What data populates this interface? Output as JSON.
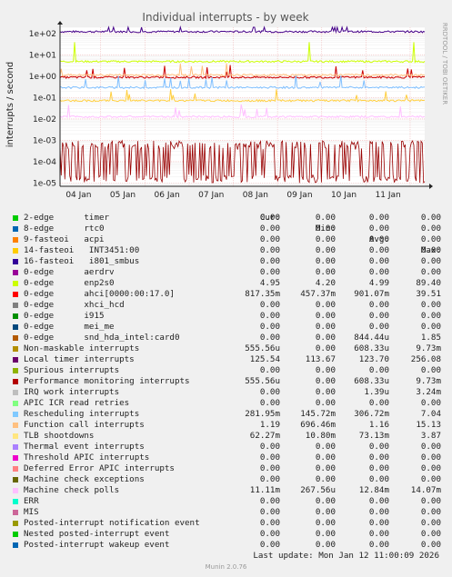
{
  "chart_data": {
    "type": "line",
    "title": "Individual interrupts - by week",
    "ylabel": "interrupts / second",
    "yscale": "log",
    "ylim": [
      7e-06,
      200
    ],
    "yticks": [
      "1e+02",
      "1e+01",
      "1e+00",
      "1e-01",
      "1e-02",
      "1e-03",
      "1e-04",
      "1e-05"
    ],
    "xticks": [
      "04 Jan",
      "05 Jan",
      "06 Jan",
      "07 Jan",
      "08 Jan",
      "09 Jan",
      "10 Jan",
      "11 Jan"
    ],
    "side_text": "RRDTOOL / TOBI OETIKER",
    "grid": true,
    "series": [
      {
        "name": "Local timer interrupts",
        "color": "#440088",
        "level": 125
      },
      {
        "name": "enp2s0",
        "color": "#ccff00",
        "level": 4.99,
        "spikes": true
      },
      {
        "name": "ahci[0000:00:17.0]",
        "color": "#cc0000",
        "level": 0.9
      },
      {
        "name": "Rescheduling interrupts",
        "color": "#7fbfff",
        "level": 0.3
      },
      {
        "name": "Function call interrupts",
        "color": "#ffbf7f",
        "level": 1.16
      },
      {
        "name": "TLB shootdowns",
        "color": "#ffcf40",
        "level": 0.073
      },
      {
        "name": "Machine check polls",
        "color": "#ffbfff",
        "level": 0.0128
      },
      {
        "name": "Performance monitoring interrupts",
        "color": "#990000",
        "level": 0.0006,
        "noisy": true
      }
    ]
  },
  "legend": {
    "headers": {
      "cur": "Cur:",
      "min": "Min:",
      "avg": "Avg:",
      "max": "Max:"
    },
    "rows": [
      {
        "label": "2-edge      timer",
        "color": "#00cc00",
        "cur": "0.00",
        "min": "0.00",
        "avg": "0.00",
        "max": "0.00"
      },
      {
        "label": "8-edge      rtc0",
        "color": "#0066b3",
        "cur": "0.00",
        "min": "0.00",
        "avg": "0.00",
        "max": "0.00"
      },
      {
        "label": "9-fasteoi   acpi",
        "color": "#ff8000",
        "cur": "0.00",
        "min": "0.00",
        "avg": "0.00",
        "max": "0.00"
      },
      {
        "label": "14-fasteoi   INT3451:00",
        "color": "#ffcc00",
        "cur": "0.00",
        "min": "0.00",
        "avg": "0.00",
        "max": "0.00"
      },
      {
        "label": "16-fasteoi   i801_smbus",
        "color": "#330099",
        "cur": "0.00",
        "min": "0.00",
        "avg": "0.00",
        "max": "0.00"
      },
      {
        "label": "0-edge      aerdrv",
        "color": "#990099",
        "cur": "0.00",
        "min": "0.00",
        "avg": "0.00",
        "max": "0.00"
      },
      {
        "label": "0-edge      enp2s0",
        "color": "#ccff00",
        "cur": "4.95",
        "min": "4.20",
        "avg": "4.99",
        "max": "89.40"
      },
      {
        "label": "0-edge      ahci[0000:00:17.0]",
        "color": "#ff0000",
        "cur": "817.35m",
        "min": "457.37m",
        "avg": "901.07m",
        "max": "39.51"
      },
      {
        "label": "0-edge      xhci_hcd",
        "color": "#808080",
        "cur": "0.00",
        "min": "0.00",
        "avg": "0.00",
        "max": "0.00"
      },
      {
        "label": "0-edge      i915",
        "color": "#008f00",
        "cur": "0.00",
        "min": "0.00",
        "avg": "0.00",
        "max": "0.00"
      },
      {
        "label": "0-edge      mei_me",
        "color": "#00487d",
        "cur": "0.00",
        "min": "0.00",
        "avg": "0.00",
        "max": "0.00"
      },
      {
        "label": "0-edge      snd_hda_intel:card0",
        "color": "#b35a00",
        "cur": "0.00",
        "min": "0.00",
        "avg": "844.44u",
        "max": "1.85"
      },
      {
        "label": "Non-maskable interrupts",
        "color": "#b38f00",
        "cur": "555.56u",
        "min": "0.00",
        "avg": "608.33u",
        "max": "9.73m"
      },
      {
        "label": "Local timer interrupts",
        "color": "#6b006b",
        "cur": "125.54",
        "min": "113.67",
        "avg": "123.70",
        "max": "256.08"
      },
      {
        "label": "Spurious interrupts",
        "color": "#8fb300",
        "cur": "0.00",
        "min": "0.00",
        "avg": "0.00",
        "max": "0.00"
      },
      {
        "label": "Performance monitoring interrupts",
        "color": "#b30000",
        "cur": "555.56u",
        "min": "0.00",
        "avg": "608.33u",
        "max": "9.73m"
      },
      {
        "label": "IRQ work interrupts",
        "color": "#bebebe",
        "cur": "0.00",
        "min": "0.00",
        "avg": "1.39u",
        "max": "3.24m"
      },
      {
        "label": "APIC ICR read retries",
        "color": "#80ff80",
        "cur": "0.00",
        "min": "0.00",
        "avg": "0.00",
        "max": "0.00"
      },
      {
        "label": "Rescheduling interrupts",
        "color": "#80c9ff",
        "cur": "281.95m",
        "min": "145.72m",
        "avg": "306.72m",
        "max": "7.04"
      },
      {
        "label": "Function call interrupts",
        "color": "#ffc080",
        "cur": "1.19",
        "min": "696.46m",
        "avg": "1.16",
        "max": "15.13"
      },
      {
        "label": "TLB shootdowns",
        "color": "#ffe680",
        "cur": "62.27m",
        "min": "10.80m",
        "avg": "73.13m",
        "max": "3.87"
      },
      {
        "label": "Thermal event interrupts",
        "color": "#aa80ff",
        "cur": "0.00",
        "min": "0.00",
        "avg": "0.00",
        "max": "0.00"
      },
      {
        "label": "Threshold APIC interrupts",
        "color": "#ee00cc",
        "cur": "0.00",
        "min": "0.00",
        "avg": "0.00",
        "max": "0.00"
      },
      {
        "label": "Deferred Error APIC interrupts",
        "color": "#ff8080",
        "cur": "0.00",
        "min": "0.00",
        "avg": "0.00",
        "max": "0.00"
      },
      {
        "label": "Machine check exceptions",
        "color": "#666600",
        "cur": "0.00",
        "min": "0.00",
        "avg": "0.00",
        "max": "0.00"
      },
      {
        "label": "Machine check polls",
        "color": "#ffbfff",
        "cur": "11.11m",
        "min": "267.56u",
        "avg": "12.84m",
        "max": "14.07m"
      },
      {
        "label": "ERR",
        "color": "#00ffcc",
        "cur": "0.00",
        "min": "0.00",
        "avg": "0.00",
        "max": "0.00"
      },
      {
        "label": "MIS",
        "color": "#cc6699",
        "cur": "0.00",
        "min": "0.00",
        "avg": "0.00",
        "max": "0.00"
      },
      {
        "label": "Posted-interrupt notification event",
        "color": "#999900",
        "cur": "0.00",
        "min": "0.00",
        "avg": "0.00",
        "max": "0.00"
      },
      {
        "label": "Nested posted-interrupt event",
        "color": "#00cc00",
        "cur": "0.00",
        "min": "0.00",
        "avg": "0.00",
        "max": "0.00"
      },
      {
        "label": "Posted-interrupt wakeup event",
        "color": "#0066b3",
        "cur": "0.00",
        "min": "0.00",
        "avg": "0.00",
        "max": "0.00"
      }
    ]
  },
  "footer": {
    "last_update": "Last update: Mon Jan 12 11:00:09 2026",
    "version": "Munin 2.0.76"
  }
}
